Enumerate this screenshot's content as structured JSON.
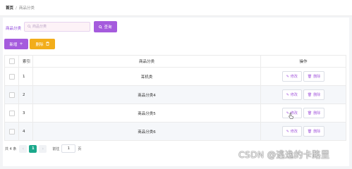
{
  "breadcrumb": {
    "home": "首页",
    "separator": "/",
    "current": "商品分类"
  },
  "search": {
    "label": "商品分类",
    "placeholder": "商品分类",
    "value": "",
    "query_button": "查询"
  },
  "actions": {
    "add_label": "新增",
    "add_icon": "+",
    "delete_label": "删除",
    "delete_icon": "🗑"
  },
  "table": {
    "columns": {
      "index": "索引",
      "name": "商品分类",
      "ops": "操作"
    },
    "rows": [
      {
        "index": "1",
        "name": "耳机类"
      },
      {
        "index": "2",
        "name": "商品分类4"
      },
      {
        "index": "3",
        "name": "商品分类5"
      },
      {
        "index": "4",
        "name": "商品分类6"
      }
    ],
    "edit_label": "修改",
    "delete_label": "删除"
  },
  "pagination": {
    "total": "共 4 条",
    "prev": "‹",
    "current_page": "1",
    "next": "›",
    "goto_label": "前往",
    "goto_value": "1",
    "page_unit": "页"
  },
  "watermark": "CSDN @逃逸的卡路里",
  "colors": {
    "accent": "#a55bdd",
    "warning": "#f2ad1a",
    "page_active": "#1aa88b"
  }
}
